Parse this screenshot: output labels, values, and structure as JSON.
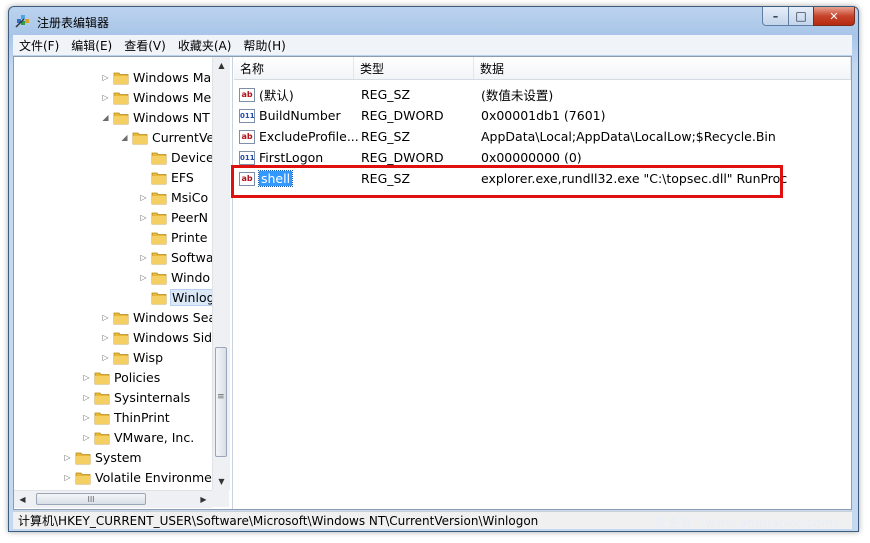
{
  "window": {
    "title": "注册表编辑器",
    "controls": {
      "minimize": "–",
      "maximize": "□",
      "close": "✕"
    }
  },
  "menu": [
    "文件(F)",
    "编辑(E)",
    "查看(V)",
    "收藏夹(A)",
    "帮助(H)"
  ],
  "tree": [
    {
      "label": "Windows Ma",
      "expander": "▷",
      "indent": 5
    },
    {
      "label": "Windows Me",
      "expander": "▷",
      "indent": 5
    },
    {
      "label": "Windows NT",
      "expander": "◢",
      "indent": 5
    },
    {
      "label": "CurrentVe",
      "expander": "◢",
      "indent": 6
    },
    {
      "label": "Device",
      "expander": "",
      "indent": 7
    },
    {
      "label": "EFS",
      "expander": "",
      "indent": 7
    },
    {
      "label": "MsiCo",
      "expander": "▷",
      "indent": 7
    },
    {
      "label": "PeerN",
      "expander": "▷",
      "indent": 7
    },
    {
      "label": "Printe",
      "expander": "",
      "indent": 7
    },
    {
      "label": "Softwa",
      "expander": "▷",
      "indent": 7
    },
    {
      "label": "Windo",
      "expander": "▷",
      "indent": 7
    },
    {
      "label": "Winlog",
      "expander": "",
      "indent": 7,
      "selected": true
    },
    {
      "label": "Windows Sea",
      "expander": "▷",
      "indent": 5
    },
    {
      "label": "Windows Sid",
      "expander": "▷",
      "indent": 5
    },
    {
      "label": "Wisp",
      "expander": "▷",
      "indent": 5
    },
    {
      "label": "Policies",
      "expander": "▷",
      "indent": 4
    },
    {
      "label": "Sysinternals",
      "expander": "▷",
      "indent": 4
    },
    {
      "label": "ThinPrint",
      "expander": "▷",
      "indent": 4
    },
    {
      "label": "VMware, Inc.",
      "expander": "▷",
      "indent": 4
    },
    {
      "label": "System",
      "expander": "▷",
      "indent": 3
    },
    {
      "label": "Volatile Environmen",
      "expander": "▷",
      "indent": 3
    }
  ],
  "scroll": {
    "up": "▲",
    "down": "▼",
    "left": "◀",
    "right": "▶",
    "grip": "III",
    "vgrip": "≡"
  },
  "columns": {
    "name": "名称",
    "type": "类型",
    "data": "数据"
  },
  "values": [
    {
      "icon": "string",
      "name": "(默认)",
      "type": "REG_SZ",
      "data": "(数值未设置)"
    },
    {
      "icon": "binary",
      "name": "BuildNumber",
      "type": "REG_DWORD",
      "data": "0x00001db1 (7601)"
    },
    {
      "icon": "string",
      "name": "ExcludeProfile...",
      "type": "REG_SZ",
      "data": "AppData\\Local;AppData\\LocalLow;$Recycle.Bin"
    },
    {
      "icon": "binary",
      "name": "FirstLogon",
      "type": "REG_DWORD",
      "data": "0x00000000 (0)"
    },
    {
      "icon": "string",
      "name": "shell",
      "type": "REG_SZ",
      "data": "explorer.exe,rundll32.exe \"C:\\topsec.dll\" RunProc",
      "selected": true
    }
  ],
  "status": "计算机\\HKEY_CURRENT_USER\\Software\\Microsoft\\Windows NT\\CurrentVersion\\Winlogon",
  "watermark": "安全客（www.anquanke.com）",
  "colors": {
    "selection": "#3399ff",
    "highlight_box": "#e01010",
    "folder": "#e8b838"
  }
}
